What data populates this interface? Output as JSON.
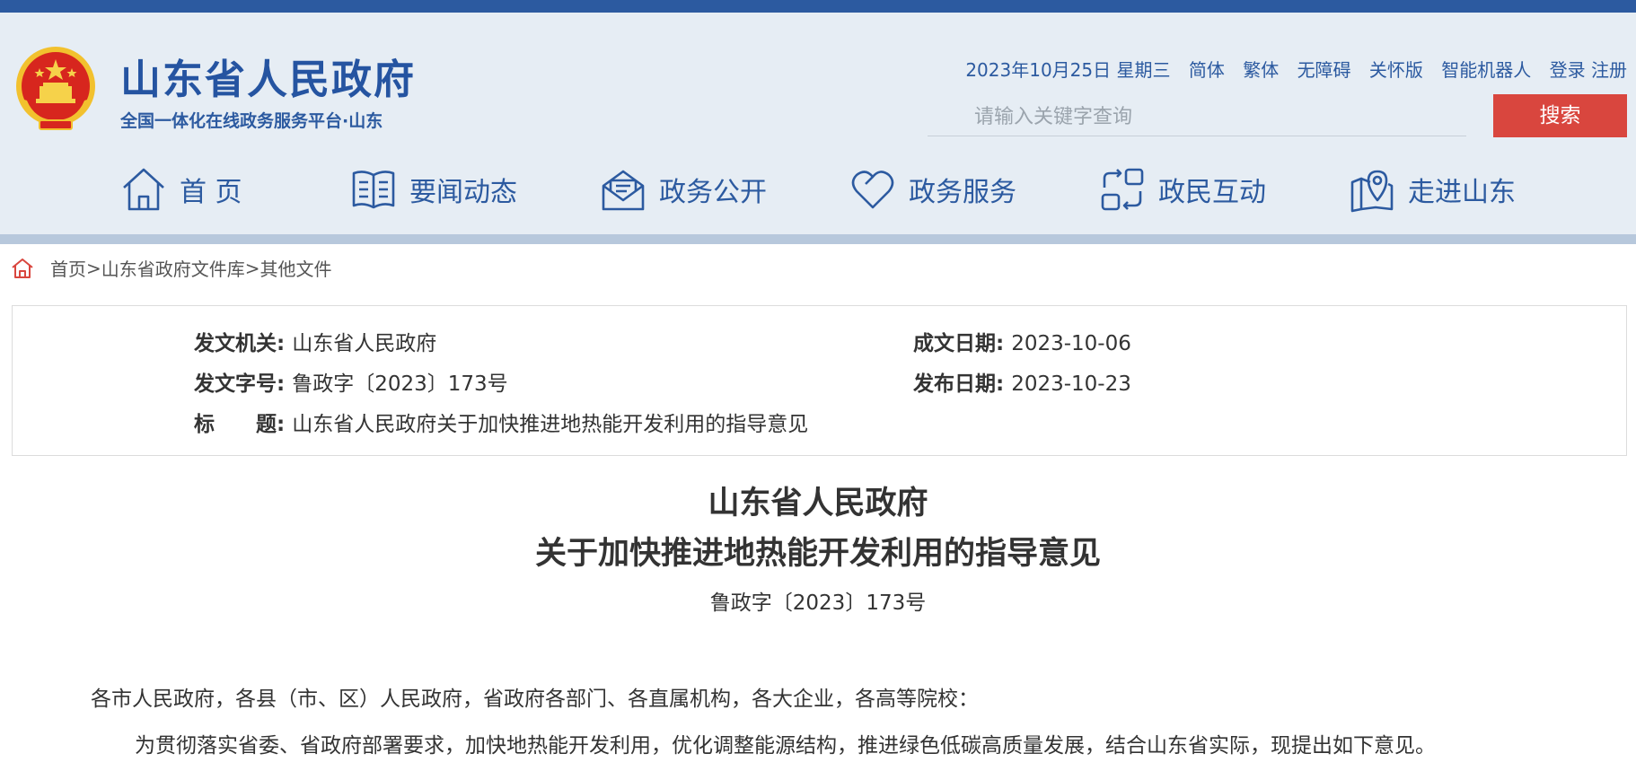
{
  "header": {
    "site_title": "山东省人民政府",
    "site_subtitle": "全国一体化在线政务服务平台·山东",
    "emblem": "national-emblem"
  },
  "toplinks": {
    "date": "2023年10月25日 星期三",
    "simplified": "简体",
    "traditional": "繁体",
    "accessible": "无障碍",
    "care": "关怀版",
    "robot": "智能机器人",
    "login_register": "登录 注册"
  },
  "search": {
    "placeholder": "请输入关键字查询",
    "button": "搜索"
  },
  "nav": {
    "items": [
      {
        "label": "首 页",
        "icon": "home-icon"
      },
      {
        "label": "要闻动态",
        "icon": "book-icon"
      },
      {
        "label": "政务公开",
        "icon": "envelope-icon"
      },
      {
        "label": "政务服务",
        "icon": "heart-icon"
      },
      {
        "label": "政民互动",
        "icon": "interaction-icon"
      },
      {
        "label": "走进山东",
        "icon": "map-pin-icon"
      }
    ]
  },
  "breadcrumb": {
    "home": "首页",
    "sep1": ">",
    "library": "山东省政府文件库",
    "sep2": ">",
    "current": "其他文件"
  },
  "doc_info": {
    "issuer_label": "发文机关:",
    "issuer": "山东省人民政府",
    "doc_no_label": "发文字号:",
    "doc_no": "鲁政字〔2023〕173号",
    "title_label": "标　　题:",
    "title": "山东省人民政府关于加快推进地热能开发利用的指导意见",
    "written_date_label": "成文日期:",
    "written_date": "2023-10-06",
    "publish_date_label": "发布日期:",
    "publish_date": "2023-10-23"
  },
  "document": {
    "title_line1": "山东省人民政府",
    "title_line2": "关于加快推进地热能开发利用的指导意见",
    "number": "鲁政字〔2023〕173号",
    "salutation": "各市人民政府，各县（市、区）人民政府，省政府各部门、各直属机构，各大企业，各高等院校：",
    "paragraph1": "为贯彻落实省委、省政府部署要求，加快地热能开发利用，优化调整能源结构，推进绿色低碳高质量发展，结合山东省实际，现提出如下意见。"
  },
  "colors": {
    "brand_blue": "#2c5aa0",
    "header_bg": "#e6edf4",
    "search_red": "#d9463e",
    "breadcrumb_home_red": "#d9463e"
  }
}
